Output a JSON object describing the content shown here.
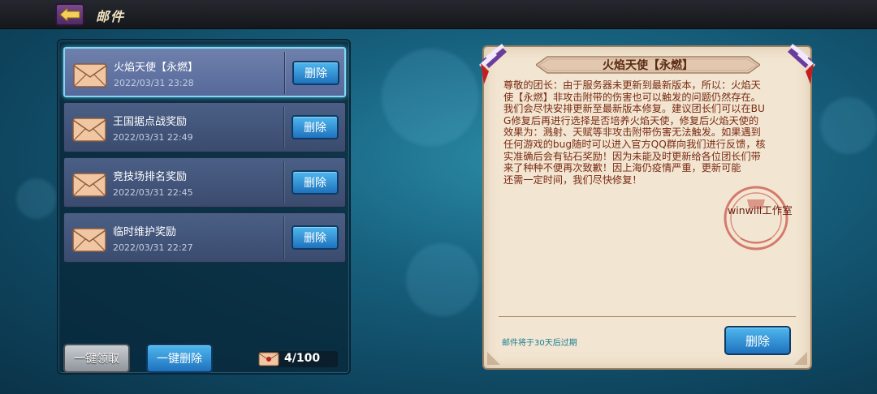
{
  "header": {
    "title": "邮件",
    "back_icon": "arrow-left-icon"
  },
  "mail_list": [
    {
      "title": "火焰天使【永燃】",
      "date": "2022/03/31 23:28",
      "delete_label": "删除",
      "selected": true
    },
    {
      "title": "王国据点战奖励",
      "date": "2022/03/31 22:49",
      "delete_label": "删除",
      "selected": false
    },
    {
      "title": "竞技场排名奖励",
      "date": "2022/03/31 22:45",
      "delete_label": "删除",
      "selected": false
    },
    {
      "title": "临时维护奖励",
      "date": "2022/03/31 22:27",
      "delete_label": "删除",
      "selected": false
    }
  ],
  "footer": {
    "claim_all_label": "一键领取",
    "delete_all_label": "一键删除",
    "mail_count": "4/100"
  },
  "letter": {
    "title": "火焰天使【永燃】",
    "body": "尊敬的团长：由于服务器未更新到最新版本，所以：火焰天\n使【永燃】非攻击附带的伤害也可以触发的问题仍然存在。\n我们会尽快安排更新至最新版本修复。建议团长们可以在BU\nG修复后再进行选择是否培养火焰天使，修复后火焰天使的\n效果为：溅射、天赋等非攻击附带伤害无法触发。如果遇到\n任何游戏的bug随时可以进入官方QQ群向我们进行反馈，核\n实准确后会有钻石奖励！因为未能及时更新给各位团长们带\n来了种种不便再次致歉！因上海仍疫情严重，更新可能\n还需一定时间，我们尽快修复！",
    "signature": "winwill工作室",
    "expire_note": "邮件将于30天后过期",
    "delete_label": "删除"
  },
  "colors": {
    "accent_blue": "#1f72bd",
    "letter_paper": "#f2e6d2",
    "letter_text": "#7a2a12",
    "expire_text": "#1b7f92"
  }
}
